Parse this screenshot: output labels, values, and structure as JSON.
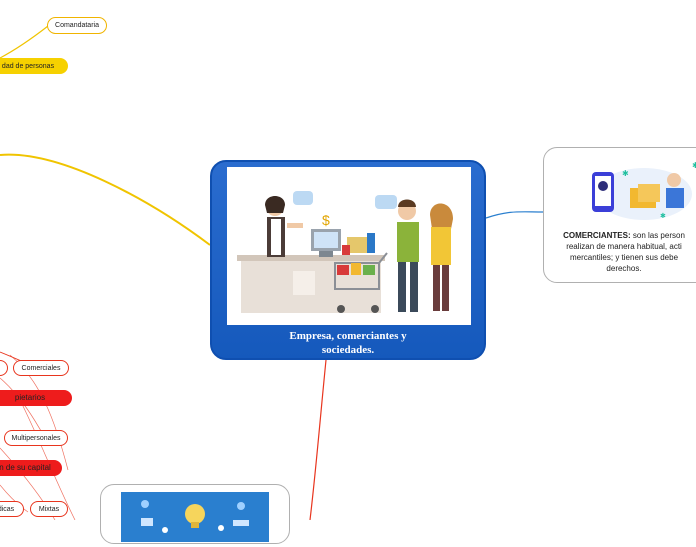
{
  "central_topic": {
    "title_line1": "Empresa, comerciantes y",
    "title_line2": "sociedades."
  },
  "topics": {
    "comandataria": "Comandataria",
    "sociedad_personas": "dad de personas",
    "comerciales": "Comerciales",
    "propietarios": "pietarios",
    "multipersonales": "Multipersonales",
    "capital": "n de su capital",
    "juridicas": "dicas",
    "mixtas": "Mixtas"
  },
  "comerciantes_card": {
    "bold_label": "COMERCIANTES:",
    "line1_rest": " son las person",
    "line2": "realizan de manera habitual, acti",
    "line3": "mercantiles; y tienen sus debe",
    "line4": "derechos."
  },
  "colors": {
    "central_blue": "#1559bc",
    "orange_branch": "#f0b400",
    "red_branch": "#e8351e",
    "blue_branch": "#2a7fcf"
  }
}
